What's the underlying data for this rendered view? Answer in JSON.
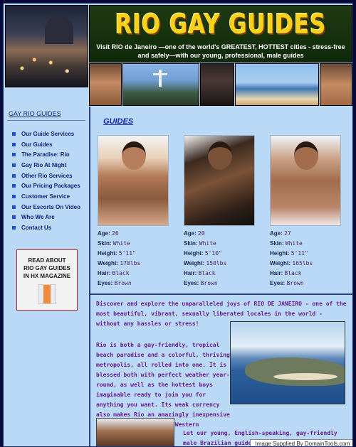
{
  "header": {
    "title": "RIO GAY GUIDES",
    "tagline": "Visit RIO de Janeiro —one of the world's GREATEST, HOTTEST cities - stress-free and safely—with our young, professional, male guides"
  },
  "sidebar": {
    "title": "GAY RIO GUIDES",
    "items": [
      {
        "label": "Our Guide Services"
      },
      {
        "label": "Our Guides"
      },
      {
        "label": "The Paradise: Rio"
      },
      {
        "label": "Gay Rio At Night"
      },
      {
        "label": "Other Rio Services"
      },
      {
        "label": "Our Pricing Packages"
      },
      {
        "label": "Customer Service"
      },
      {
        "label": "Our Escorts On Video"
      },
      {
        "label": "Who We Are"
      },
      {
        "label": "Contact Us"
      }
    ],
    "promo": {
      "line1": "READ ABOUT",
      "line2": "RIO GAY GUIDES",
      "line3": "IN HX MAGAZINE"
    }
  },
  "main": {
    "section_title": "GUIDES",
    "labels": {
      "age": "Age: ",
      "skin": "Skin: ",
      "height": "Height: ",
      "weight": "Weight: ",
      "hair": "Hair: ",
      "eyes": "Eyes: "
    },
    "guides": [
      {
        "age": "26",
        "skin": "White",
        "height": "5'11\"",
        "weight": "170lbs",
        "hair": "Black",
        "eyes": "Brown"
      },
      {
        "age": "20",
        "skin": "White",
        "height": "5'10\"",
        "weight": "150lbs",
        "hair": "Black",
        "eyes": "Brown"
      },
      {
        "age": "27",
        "skin": "White",
        "height": "5'11\"",
        "weight": "165lbs",
        "hair": "Black",
        "eyes": "Brown"
      }
    ],
    "paragraphs": [
      "Discover and explore the unparalleled joys of RIO DE JANEIRO - one of the most beautiful, vibrant, sexually liberated locales in the world - without any hassles or stress!",
      "Rio is both a gay-friendly, tropical beach paradise and a colorful, thriving metropolis, all rolled into one. It is blessed both with perfect weather year-round, as well as the hottest boys imaginable ready to join you for anything you want. Its weak currency also makes Rio an amazingly inexpensive place to visit for the Western traveler.",
      "Let our young, English-speaking, gay-friendly male Brazilian guides do all of the work for you and"
    ]
  },
  "footer": {
    "credit": "Image Supplied By DomainTools.com"
  }
}
